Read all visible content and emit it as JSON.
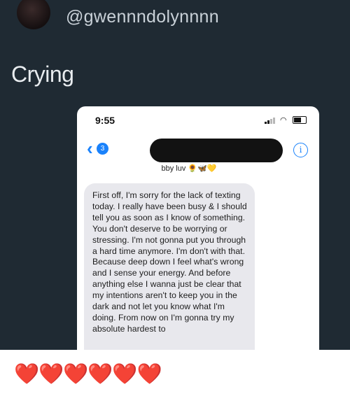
{
  "post": {
    "handle": "@gwennndolynnnn",
    "caption": "Crying",
    "reaction": "❤️❤️❤️❤️❤️❤️"
  },
  "phone": {
    "time": "9:55",
    "back_badge": "3",
    "contact_name": "bby luv 🌻🦋💛",
    "message": "First off, I'm sorry for the lack of texting today. I really have been busy & I should tell you as soon as I know of something. You don't deserve to be worrying or stressing. I'm not gonna put you through a hard time anymore. I'm don't with that. Because deep down I feel what's wrong and I sense your energy. And before anything else I wanna just be clear that my intentions aren't to keep you in the dark and not let you know what I'm doing. From now on I'm gonna try my absolute hardest to"
  },
  "icons": {
    "back": "chevron-left-icon",
    "info": "info-icon",
    "signal": "signal-icon",
    "wifi": "wifi-icon",
    "battery": "battery-icon"
  },
  "colors": {
    "background": "#1f2a33",
    "ios_blue": "#1a82fb",
    "bubble": "#e8e8ed",
    "heart": "#d9182d"
  }
}
